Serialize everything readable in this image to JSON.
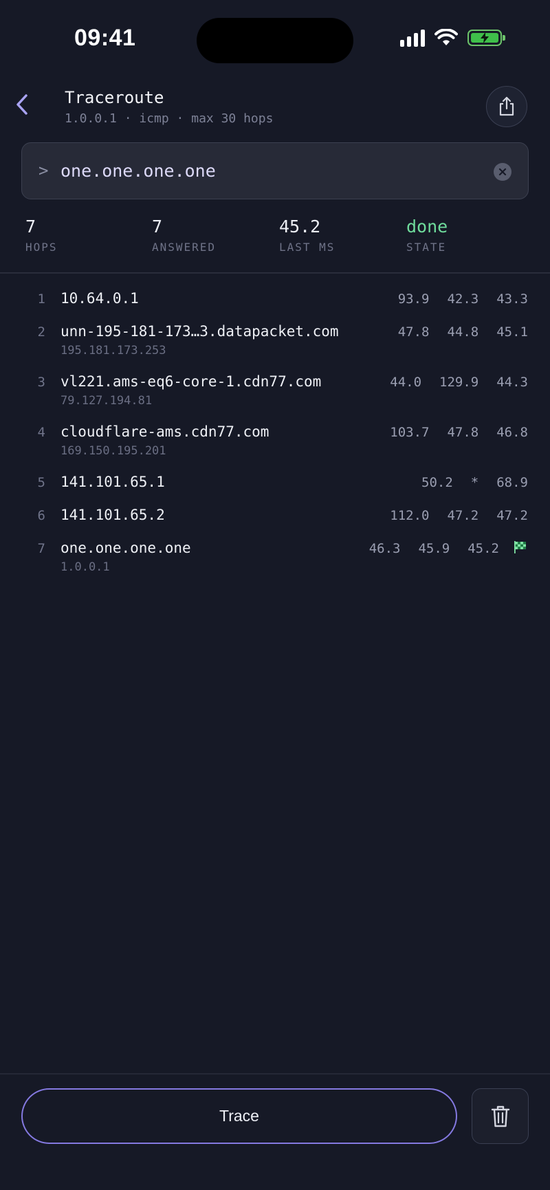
{
  "status_bar": {
    "time": "09:41",
    "icons": [
      "cellular-signal-icon",
      "wifi-icon",
      "battery-charging-icon"
    ]
  },
  "header": {
    "title": "Traceroute",
    "subtitle": "1.0.0.1 · icmp · max 30 hops",
    "back_icon": "chevron-left-icon",
    "share_icon": "share-icon"
  },
  "search": {
    "prompt": ">",
    "value": "one.one.one.one",
    "clear_icon": "clear-circle-icon"
  },
  "stats": [
    {
      "value": "7",
      "label": "HOPS"
    },
    {
      "value": "7",
      "label": "ANSWERED"
    },
    {
      "value": "45.2",
      "label": "LAST MS"
    },
    {
      "value": "done",
      "label": "STATE"
    }
  ],
  "hops": [
    {
      "num": "1",
      "host": "10.64.0.1",
      "ip": "",
      "rtt": [
        "93.9",
        "42.3",
        "43.3"
      ]
    },
    {
      "num": "2",
      "host": "unn-195-181-173…3.datapacket.com",
      "ip": "195.181.173.253",
      "rtt": [
        "47.8",
        "44.8",
        "45.1"
      ]
    },
    {
      "num": "3",
      "host": "vl221.ams-eq6-core-1.cdn77.com",
      "ip": "79.127.194.81",
      "rtt": [
        "44.0",
        "129.9",
        "44.3"
      ]
    },
    {
      "num": "4",
      "host": "cloudflare-ams.cdn77.com",
      "ip": "169.150.195.201",
      "rtt": [
        "103.7",
        "47.8",
        "46.8"
      ]
    },
    {
      "num": "5",
      "host": "141.101.65.1",
      "ip": "",
      "rtt": [
        "50.2",
        "*",
        "68.9"
      ]
    },
    {
      "num": "6",
      "host": "141.101.65.2",
      "ip": "",
      "rtt": [
        "112.0",
        "47.2",
        "47.2"
      ]
    },
    {
      "num": "7",
      "host": "one.one.one.one",
      "ip": "1.0.0.1",
      "rtt": [
        "46.3",
        "45.9",
        "45.2"
      ],
      "destination_icon": "checkered-flag-icon"
    }
  ],
  "actions": {
    "trace_label": "Trace",
    "delete_icon": "trash-icon"
  },
  "colors": {
    "background": "#161926",
    "accent": "#8479e0",
    "done": "#6fdc9c"
  }
}
